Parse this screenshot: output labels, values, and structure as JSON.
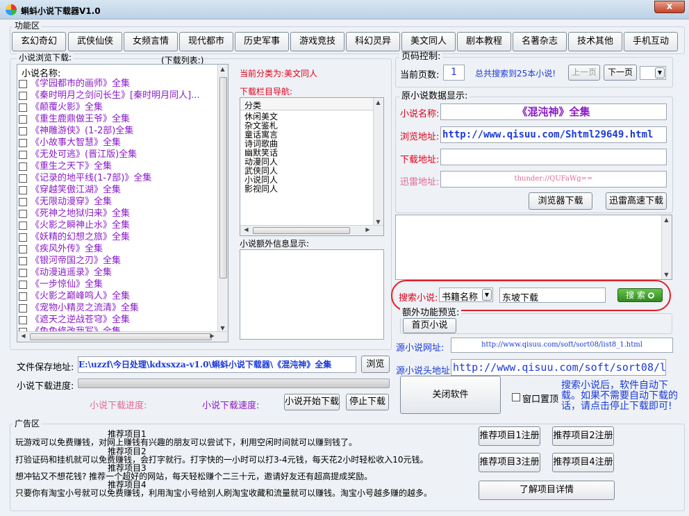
{
  "window": {
    "title": "蝌蚪小说下载器V1.0",
    "close": "x"
  },
  "func_area": "功能区",
  "tabs": [
    "玄幻奇幻",
    "武侠仙侠",
    "女频言情",
    "现代都市",
    "历史军事",
    "游戏竞技",
    "科幻灵异",
    "美文同人",
    "剧本教程",
    "名著杂志",
    "技术其他",
    "手机互动"
  ],
  "browse": {
    "legend": "小说浏览下载:",
    "download_list": "(下载列表:)",
    "header": "小说名称:"
  },
  "novels": [
    "《学园都市的画师》全集",
    "《秦时明月之剑问长生》[秦时明月同人]...",
    "《颠覆火影》全集",
    "《重生鹿鼎做王爷》全集",
    "《神雕游侠》(1-2部)全集",
    "《小故事大智慧》全集",
    "《无处可逃》(晋江版)全集",
    "《重生之天下》全集",
    "《记录的地平线(1-7部)》全集",
    "《穿越笑傲江湖》全集",
    "《无限动漫穿》全集",
    "《死神之地狱归来》全集",
    "《火影之瞬神止水》全集",
    "《妖精的幻想之旅》全集",
    "《疾风外传》全集",
    "《银河帝国之刃》全集",
    "《动漫逍遥录》全集",
    "《一步惊仙》全集",
    "《火影之巅峰鸣人》全集",
    "《宠物小精灵之流清》全集",
    "《遮天之逆战苍穹》全集",
    "《兔兔修改我写》全集"
  ],
  "category": {
    "current_label": "当前分类为:美文同人",
    "nav_label": "下载栏目导航:",
    "header": "分类",
    "items": [
      "休闲美文",
      "杂文鉴札",
      "童话寓言",
      "诗词歌曲",
      "幽默笑话",
      "动漫同人",
      "武侠同人",
      "小说同人",
      "影视同人"
    ],
    "extra_label": "小说额外信息显示:"
  },
  "paging": {
    "legend": "页码控制:",
    "current_page_label": "当前页数:",
    "current_page": "1",
    "total": "总共搜索到25本小说!",
    "prev": "上一页",
    "next": "下一页"
  },
  "original": {
    "legend": "原小说数据显示:",
    "name_label": "小说名称:",
    "name": "《混沌神》全集",
    "browse_label": "浏览地址:",
    "browse_url": "http://www.qisuu.com/Shtml29649.html",
    "download_label": "下载地址:",
    "download_url": "",
    "thunder_label": "迅雷地址:",
    "thunder_url": "thunder://QUFaWg==",
    "browser_download": "浏览器下载",
    "thunder_download": "迅雷高速下载"
  },
  "search": {
    "label": "搜索小说:",
    "type": "书籍名称",
    "query": "东坡下载",
    "button": "搜 索"
  },
  "extra": {
    "legend": "额外功能预览:",
    "home_button": "首页小说",
    "url_label": "源小说网址:",
    "url": "http://www.qisuu.com/soft/sort08/list8_1.html",
    "head_label": "源小说头地址:",
    "head_url": "http://www.qisuu.com/soft/sort08/l"
  },
  "save": {
    "label": "文件保存地址:",
    "path": "E:\\uzzf\\今日处理\\kdxsxza-v1.0\\蝌蚪小说下载器\\《混沌神》全集",
    "browse": "浏览"
  },
  "progress": {
    "label": "小说下载进度:",
    "value": 0,
    "progress_text": "小说下载进度:",
    "speed_text": "小说下载速度:",
    "start": "小说开始下载",
    "stop": "停止下载"
  },
  "close_app": "关闭软件",
  "topmost": "窗口置顶",
  "notice": "搜索小说后，软件自动下载。如果不需要自动下载的话，请点击停止下载即可!",
  "ad": {
    "legend": "广告区",
    "lines": [
      "玩游戏可以免费赚钱，对网上赚钱有兴趣的朋友可以尝试下，利用空闲时间就可以赚到钱了。",
      "打验证码和挂机就可以免费赚钱，会打字就行。打字快的一小时可以打3-4元钱，每天花2小时轻松收入10元钱。",
      "想冲钻又不想花钱? 推荐一个超好的网站，每天轻松赚个二三十元，邀请好友还有超高提成奖励。",
      "只要你有淘宝小号就可以免费赚钱，利用淘宝小号给别人刷淘宝收藏和流量就可以赚钱。淘宝小号越多赚的越多。"
    ],
    "items": [
      "推荐项目1",
      "推荐项目2",
      "推荐项目3",
      "推荐项目4"
    ],
    "reg_buttons": [
      "推荐项目1注册",
      "推荐项目2注册",
      "推荐项目3注册",
      "推荐项目4注册"
    ],
    "details": "了解项目详情"
  },
  "colors": {
    "accent_red": "#e0001a",
    "purple": "#8a1ac9",
    "blue": "#1a3ad8",
    "highlight": "#e01f2a",
    "search_green": "#3c9a26"
  }
}
